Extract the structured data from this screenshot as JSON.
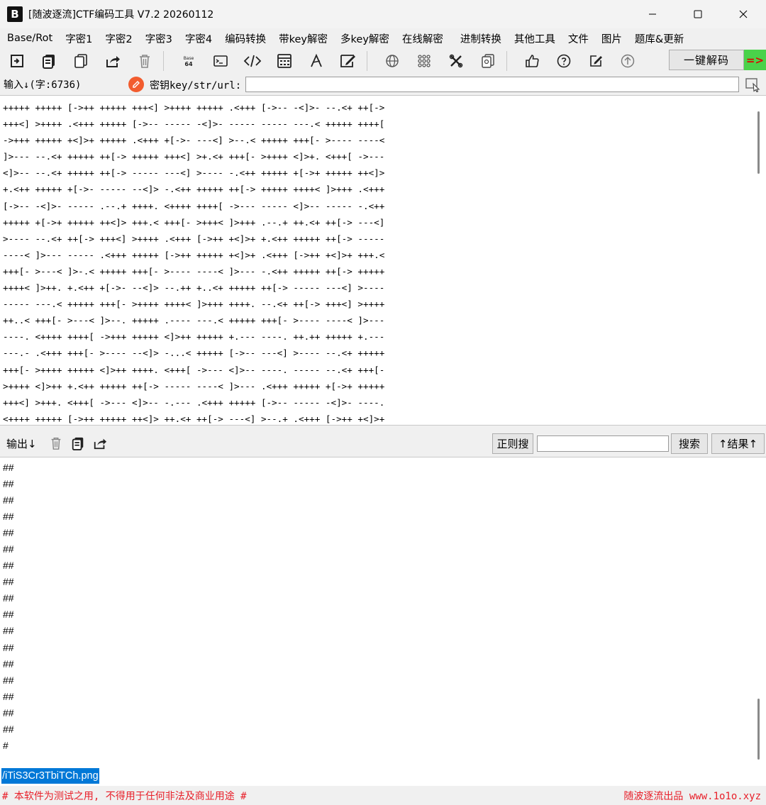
{
  "window": {
    "title": "[随波逐流]CTF编码工具 V7.2  20260112",
    "logo": "B"
  },
  "menubar": {
    "items": [
      "Base/Rot",
      "字密1",
      "字密2",
      "字密3",
      "字密4",
      "编码转换",
      "带key解密",
      "多key解密",
      "在线解密",
      "进制转换",
      "其他工具",
      "文件",
      "图片",
      "题库&更新"
    ]
  },
  "toolbar": {
    "base64_icon_text": "Base 64",
    "one_click_label": "一键解码",
    "arrow_label": "=>"
  },
  "input": {
    "label": "输入↓(字:6736)",
    "key_label": "密钥key/str/url:",
    "key_value": "",
    "lines": [
      "+++++ +++++ [->++ +++++ +++<] >++++ +++++ .<+++ [->-- -<]>- --.<+ ++[->",
      "+++<] >++++ .<+++ +++++ [->-- ----- -<]>- ----- ----- ---.< +++++ ++++[",
      "->+++ +++++ +<]>+ +++++ .<+++ +[->- ---<] >--.< +++++ +++[- >---- ----<",
      "]>--- --.<+ +++++ ++[-> +++++ +++<] >+.<+ +++[- >++++ <]>+. <+++[ ->---",
      "<]>-- --.<+ +++++ ++[-> ----- ---<] >---- -.<++ +++++ +[->+ +++++ ++<]>",
      "+.<++ +++++ +[->- ----- --<]> -.<++ +++++ ++[-> +++++ ++++< ]>+++ .<+++",
      "[->-- -<]>- ----- .--.+ ++++. <++++ ++++[ ->--- ----- <]>-- ----- -.<++",
      "+++++ +[->+ +++++ ++<]> +++.< +++[- >+++< ]>+++ .--.+ ++.<+ ++[-> ---<]",
      ">---- --.<+ ++[-> +++<] >++++ .<+++ [->++ +<]>+ +.<++ +++++ ++[-> -----",
      "----< ]>--- ----- .<+++ +++++ [->++ +++++ +<]>+ .<+++ [->++ +<]>+ +++.<",
      "+++[- >---< ]>-.< +++++ +++[- >---- ----< ]>--- -.<++ +++++ ++[-> +++++",
      "++++< ]>++. +.<++ +[->- --<]> --.++ +..<+ +++++ ++[-> ----- ---<] >----",
      "----- ---.< +++++ +++[- >++++ ++++< ]>+++ ++++. --.<+ ++[-> +++<] >++++",
      "++..< +++[- >---< ]>--. +++++ .---- ---.< +++++ +++[- >---- ----< ]>---",
      "----. <++++ ++++[ ->+++ +++++ <]>++ +++++ +.--- ----. ++.++ +++++ +.---",
      "---.- .<+++ +++[- >---- --<]> -...< +++++ [->-- ---<] >---- --.<+ +++++",
      "+++[- >++++ +++++ <]>++ ++++. <+++[ ->--- <]>-- ----. ----- --.<+ +++[-",
      ">++++ <]>++ +.<++ +++++ ++[-> ----- ----< ]>--- .<+++ +++++ +[->+ +++++",
      "+++<] >+++. <+++[ ->--- <]>-- -.--- .<+++ +++++ [->-- ----- -<]>- ----.",
      "<++++ +++++ [->++ +++++ ++<]> ++.<+ ++[-> ---<] >--.+ .<+++ [->++ +<]>+"
    ]
  },
  "output": {
    "label": "输出↓",
    "regex_label": "正则搜",
    "regex_value": "",
    "search_label": "搜索",
    "result_label": "↑结果↑",
    "lines": [
      "##",
      "##",
      "##",
      "##",
      "##",
      "##",
      "##",
      "##",
      "##",
      "##",
      "##",
      "##",
      "##",
      "##",
      "##",
      "##",
      "##",
      "#"
    ],
    "selected_text": "/iTiS3Cr3TbiTCh.png"
  },
  "status": {
    "left": "# 本软件为测试之用, 不得用于任何非法及商业用途 #",
    "right": "随波逐流出品 www.1o1o.xyz"
  }
}
